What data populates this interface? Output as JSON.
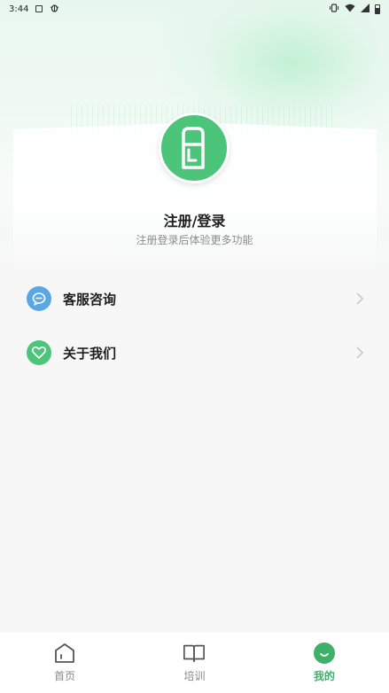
{
  "status_bar": {
    "time": "3:44",
    "icons": [
      "notification-a-icon",
      "bug-icon",
      "vibrate-icon",
      "wifi-icon",
      "signal-icon",
      "battery-icon"
    ]
  },
  "profile": {
    "avatar_icon": "user-avatar-icon",
    "login_label": "注册/登录",
    "login_hint": "注册登录后体验更多功能"
  },
  "menu": {
    "items": [
      {
        "label": "客服咨询",
        "icon": "chat-bubble-icon",
        "color": "#5aa7e6"
      },
      {
        "label": "关于我们",
        "icon": "heart-icon",
        "color": "#4cc47a"
      }
    ]
  },
  "tabbar": {
    "tabs": [
      {
        "label": "首页",
        "icon": "home-icon"
      },
      {
        "label": "培训",
        "icon": "book-icon"
      },
      {
        "label": "我的",
        "icon": "smile-icon",
        "active": true
      }
    ]
  },
  "colors": {
    "accent": "#3fb06a",
    "avatar_bg": "#4cc47a",
    "service_icon": "#5aa7e6",
    "about_icon": "#4cc47a"
  }
}
